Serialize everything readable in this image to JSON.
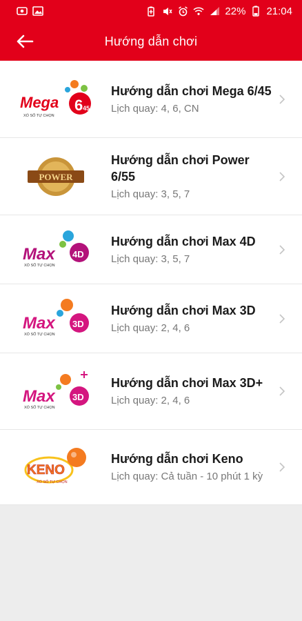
{
  "status_bar": {
    "battery": "22%",
    "time": "21:04"
  },
  "app_bar": {
    "title": "Hướng dẫn chơi"
  },
  "games": [
    {
      "title": "Hướng dẫn chơi Mega 6/45",
      "schedule": "Lịch quay: 4, 6, CN",
      "logo": "mega-645-logo"
    },
    {
      "title": "Hướng dẫn chơi Power 6/55",
      "schedule": "Lịch quay: 3, 5, 7",
      "logo": "power-655-logo"
    },
    {
      "title": "Hướng dẫn chơi Max 4D",
      "schedule": "Lịch quay: 3, 5, 7",
      "logo": "max-4d-logo"
    },
    {
      "title": "Hướng dẫn chơi Max 3D",
      "schedule": "Lịch quay: 2, 4, 6",
      "logo": "max-3d-logo"
    },
    {
      "title": "Hướng dẫn chơi Max 3D+",
      "schedule": "Lịch quay: 2, 4, 6",
      "logo": "max-3d-plus-logo"
    },
    {
      "title": "Hướng dẫn chơi Keno",
      "schedule": "Lịch quay: Cả tuần - 10 phút 1 kỳ",
      "logo": "keno-logo"
    }
  ],
  "logo_text": {
    "mega": "Mega",
    "mega_num": "6",
    "mega_sub": "45",
    "power": "POWER",
    "max": "Max",
    "max4": "4D",
    "max3": "3D",
    "keno": "KENO",
    "vietlott_tag": "XỔ SỐ TỰ CHỌN"
  },
  "colors": {
    "brand_red": "#e2001a",
    "max_purple": "#b3127a",
    "ball_orange": "#f47b20",
    "ball_blue": "#2aa5dc",
    "ball_green": "#7dc243"
  }
}
